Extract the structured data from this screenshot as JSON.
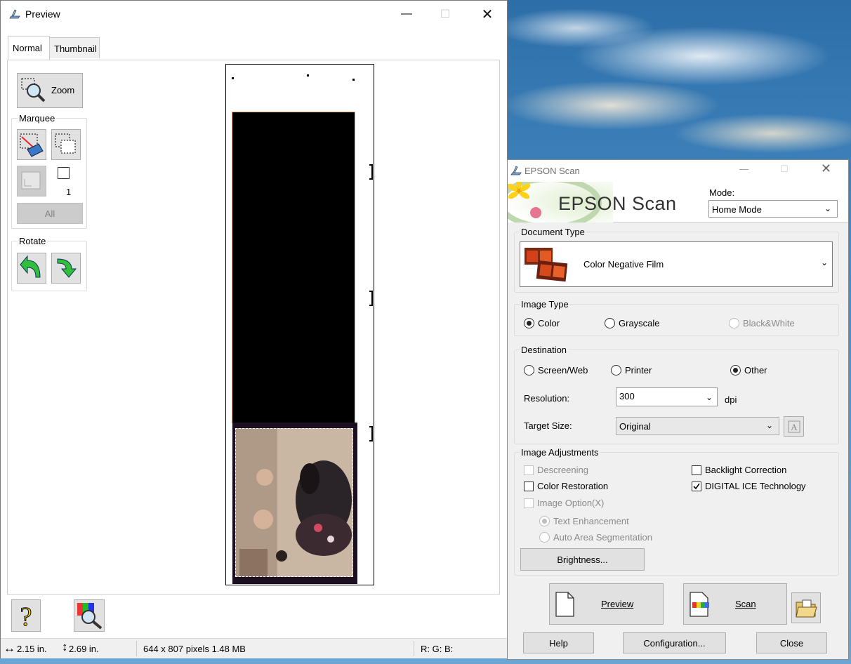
{
  "preview": {
    "title": "Preview",
    "tabs": [
      {
        "label": "Normal",
        "active": true
      },
      {
        "label": "Thumbnail",
        "active": false
      }
    ],
    "zoom_label": "Zoom",
    "marquee_label": "Marquee",
    "marquee_count": "1",
    "all_label": "All",
    "rotate_label": "Rotate",
    "status": {
      "width": "2.15 in.",
      "height": "2.69 in.",
      "pixels": "644 x 807 pixels 1.48 MB",
      "rgb": "R: G: B:"
    }
  },
  "epson": {
    "title": "EPSON Scan",
    "brand": "EPSON Scan",
    "mode_label": "Mode:",
    "mode_value": "Home Mode",
    "document_type": {
      "label": "Document Type",
      "value": "Color Negative Film"
    },
    "image_type": {
      "label": "Image Type",
      "options": [
        {
          "label": "Color",
          "selected": true,
          "enabled": true
        },
        {
          "label": "Grayscale",
          "selected": false,
          "enabled": true
        },
        {
          "label": "Black&White",
          "selected": false,
          "enabled": false
        }
      ]
    },
    "destination": {
      "label": "Destination",
      "options": [
        {
          "label": "Screen/Web",
          "selected": false
        },
        {
          "label": "Printer",
          "selected": false
        },
        {
          "label": "Other",
          "selected": true
        }
      ],
      "resolution_label": "Resolution:",
      "resolution_value": "300",
      "resolution_unit": "dpi",
      "target_size_label": "Target Size:",
      "target_size_value": "Original"
    },
    "adjustments": {
      "label": "Image Adjustments",
      "descreening": {
        "label": "Descreening",
        "checked": false,
        "enabled": false
      },
      "color_restoration": {
        "label": "Color Restoration",
        "checked": false,
        "enabled": true
      },
      "image_option": {
        "label": "Image Option(X)",
        "checked": false,
        "enabled": false
      },
      "text_enhancement": {
        "label": "Text Enhancement",
        "selected": true,
        "enabled": false
      },
      "auto_area": {
        "label": "Auto Area Segmentation",
        "selected": false,
        "enabled": false
      },
      "backlight": {
        "label": "Backlight Correction",
        "checked": false,
        "enabled": true
      },
      "digital_ice": {
        "label": "DIGITAL ICE Technology",
        "checked": true,
        "enabled": true
      },
      "brightness_label": "Brightness..."
    },
    "buttons": {
      "preview_label": "Preview",
      "scan_label": "Scan",
      "help_label": "Help",
      "configuration_label": "Configuration...",
      "close_label": "Close"
    }
  }
}
